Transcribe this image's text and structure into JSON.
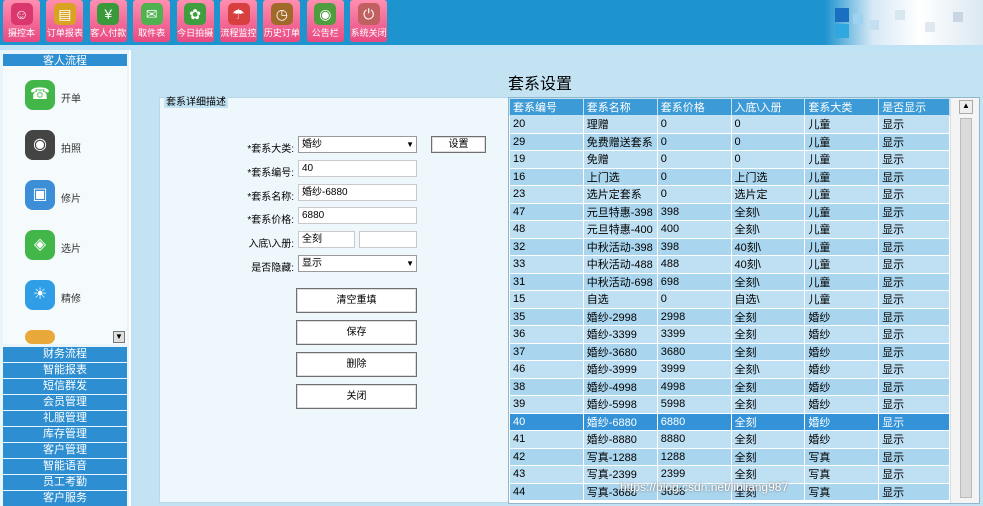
{
  "toolbar": {
    "buttons": [
      {
        "label": "摄控本",
        "icon": "person-icon",
        "color": "#d9376e"
      },
      {
        "label": "订单报表",
        "icon": "report-icon",
        "color": "#d9a321"
      },
      {
        "label": "客人付款",
        "icon": "payment-icon",
        "color": "#3a9a3a"
      },
      {
        "label": "取件表",
        "icon": "pickup-icon",
        "color": "#4fb24f"
      },
      {
        "label": "今日拍摄",
        "icon": "camera-today-icon",
        "color": "#3f9f3f"
      },
      {
        "label": "流程监控",
        "icon": "umbrella-icon",
        "color": "#d84040"
      },
      {
        "label": "历史订单",
        "icon": "history-icon",
        "color": "#a06a2a"
      },
      {
        "label": "公告栏",
        "icon": "bulletin-icon",
        "color": "#4f9d3f"
      },
      {
        "label": "系统关闭",
        "icon": "power-icon",
        "color": "#c06060"
      }
    ]
  },
  "leftnav": {
    "header": "客人流程",
    "flow_items": [
      {
        "label": "开单",
        "icon": "phone-icon",
        "color": "#43b649"
      },
      {
        "label": "拍照",
        "icon": "camera-icon",
        "color": "#444444"
      },
      {
        "label": "修片",
        "icon": "photo-edit-icon",
        "color": "#3c8fd6"
      },
      {
        "label": "选片",
        "icon": "photo-select-icon",
        "color": "#43b649"
      },
      {
        "label": "精修",
        "icon": "weather-icon",
        "color": "#2f9ee6"
      }
    ],
    "menu": [
      "财务流程",
      "智能报表",
      "短信群发",
      "会员管理",
      "礼服管理",
      "库存管理",
      "客户管理",
      "智能语音",
      "员工考勤",
      "客户服务"
    ]
  },
  "main": {
    "title": "套系设置",
    "panel_label": "套系详细描述",
    "form": {
      "category_label": "*套系大类:",
      "category_value": "婚纱",
      "settings_button": "设置",
      "code_label": "*套系编号:",
      "code_value": "40",
      "name_label": "*套系名称:",
      "name_value": "婚纱-6880",
      "price_label": "*套系价格:",
      "price_value": "6880",
      "album_label": "入底\\入册:",
      "album_value": "全刻",
      "album_value2": "",
      "hidden_label": "是否隐藏:",
      "hidden_value": "显示"
    },
    "buttons": {
      "clear": "清空重填",
      "save": "保存",
      "delete": "删除",
      "close": "关闭"
    },
    "table": {
      "columns": [
        "套系编号",
        "套系名称",
        "套系价格",
        "入底\\入册",
        "套系大类",
        "是否显示"
      ],
      "rows": [
        [
          "20",
          "理赠",
          "0",
          "0",
          "儿童",
          "显示"
        ],
        [
          "29",
          "免费赠送套系",
          "0",
          "0",
          "儿童",
          "显示"
        ],
        [
          "19",
          "免赠",
          "0",
          "0",
          "儿童",
          "显示"
        ],
        [
          "16",
          "上门选",
          "0",
          "上门选",
          "儿童",
          "显示"
        ],
        [
          "23",
          "选片定套系",
          "0",
          "选片定",
          "儿童",
          "显示"
        ],
        [
          "47",
          "元旦特惠-398",
          "398",
          "全刻\\",
          "儿童",
          "显示"
        ],
        [
          "48",
          "元旦特惠-400",
          "400",
          "全刻\\",
          "儿童",
          "显示"
        ],
        [
          "32",
          "中秋活动-398",
          "398",
          "40刻\\",
          "儿童",
          "显示"
        ],
        [
          "33",
          "中秋活动-488",
          "488",
          "40刻\\",
          "儿童",
          "显示"
        ],
        [
          "31",
          "中秋活动-698",
          "698",
          "全刻\\",
          "儿童",
          "显示"
        ],
        [
          "15",
          "自选",
          "0",
          "自选\\",
          "儿童",
          "显示"
        ],
        [
          "35",
          "婚纱-2998",
          "2998",
          "全刻",
          "婚纱",
          "显示"
        ],
        [
          "36",
          "婚纱-3399",
          "3399",
          "全刻",
          "婚纱",
          "显示"
        ],
        [
          "37",
          "婚纱-3680",
          "3680",
          "全刻",
          "婚纱",
          "显示"
        ],
        [
          "46",
          "婚纱-3999",
          "3999",
          "全刻\\",
          "婚纱",
          "显示"
        ],
        [
          "38",
          "婚纱-4998",
          "4998",
          "全刻",
          "婚纱",
          "显示"
        ],
        [
          "39",
          "婚纱-5998",
          "5998",
          "全刻",
          "婚纱",
          "显示"
        ],
        [
          "40",
          "婚纱-6880",
          "6880",
          "全刻",
          "婚纱",
          "显示"
        ],
        [
          "41",
          "婚纱-8880",
          "8880",
          "全刻",
          "婚纱",
          "显示"
        ],
        [
          "42",
          "写真-1288",
          "1288",
          "全刻",
          "写真",
          "显示"
        ],
        [
          "43",
          "写真-2399",
          "2399",
          "全刻",
          "写真",
          "显示"
        ],
        [
          "44",
          "写真-3688",
          "3688",
          "全刻",
          "写真",
          "显示"
        ]
      ],
      "selected_row": 17
    },
    "watermark": "https://blog.csdn.net/linliang987"
  }
}
